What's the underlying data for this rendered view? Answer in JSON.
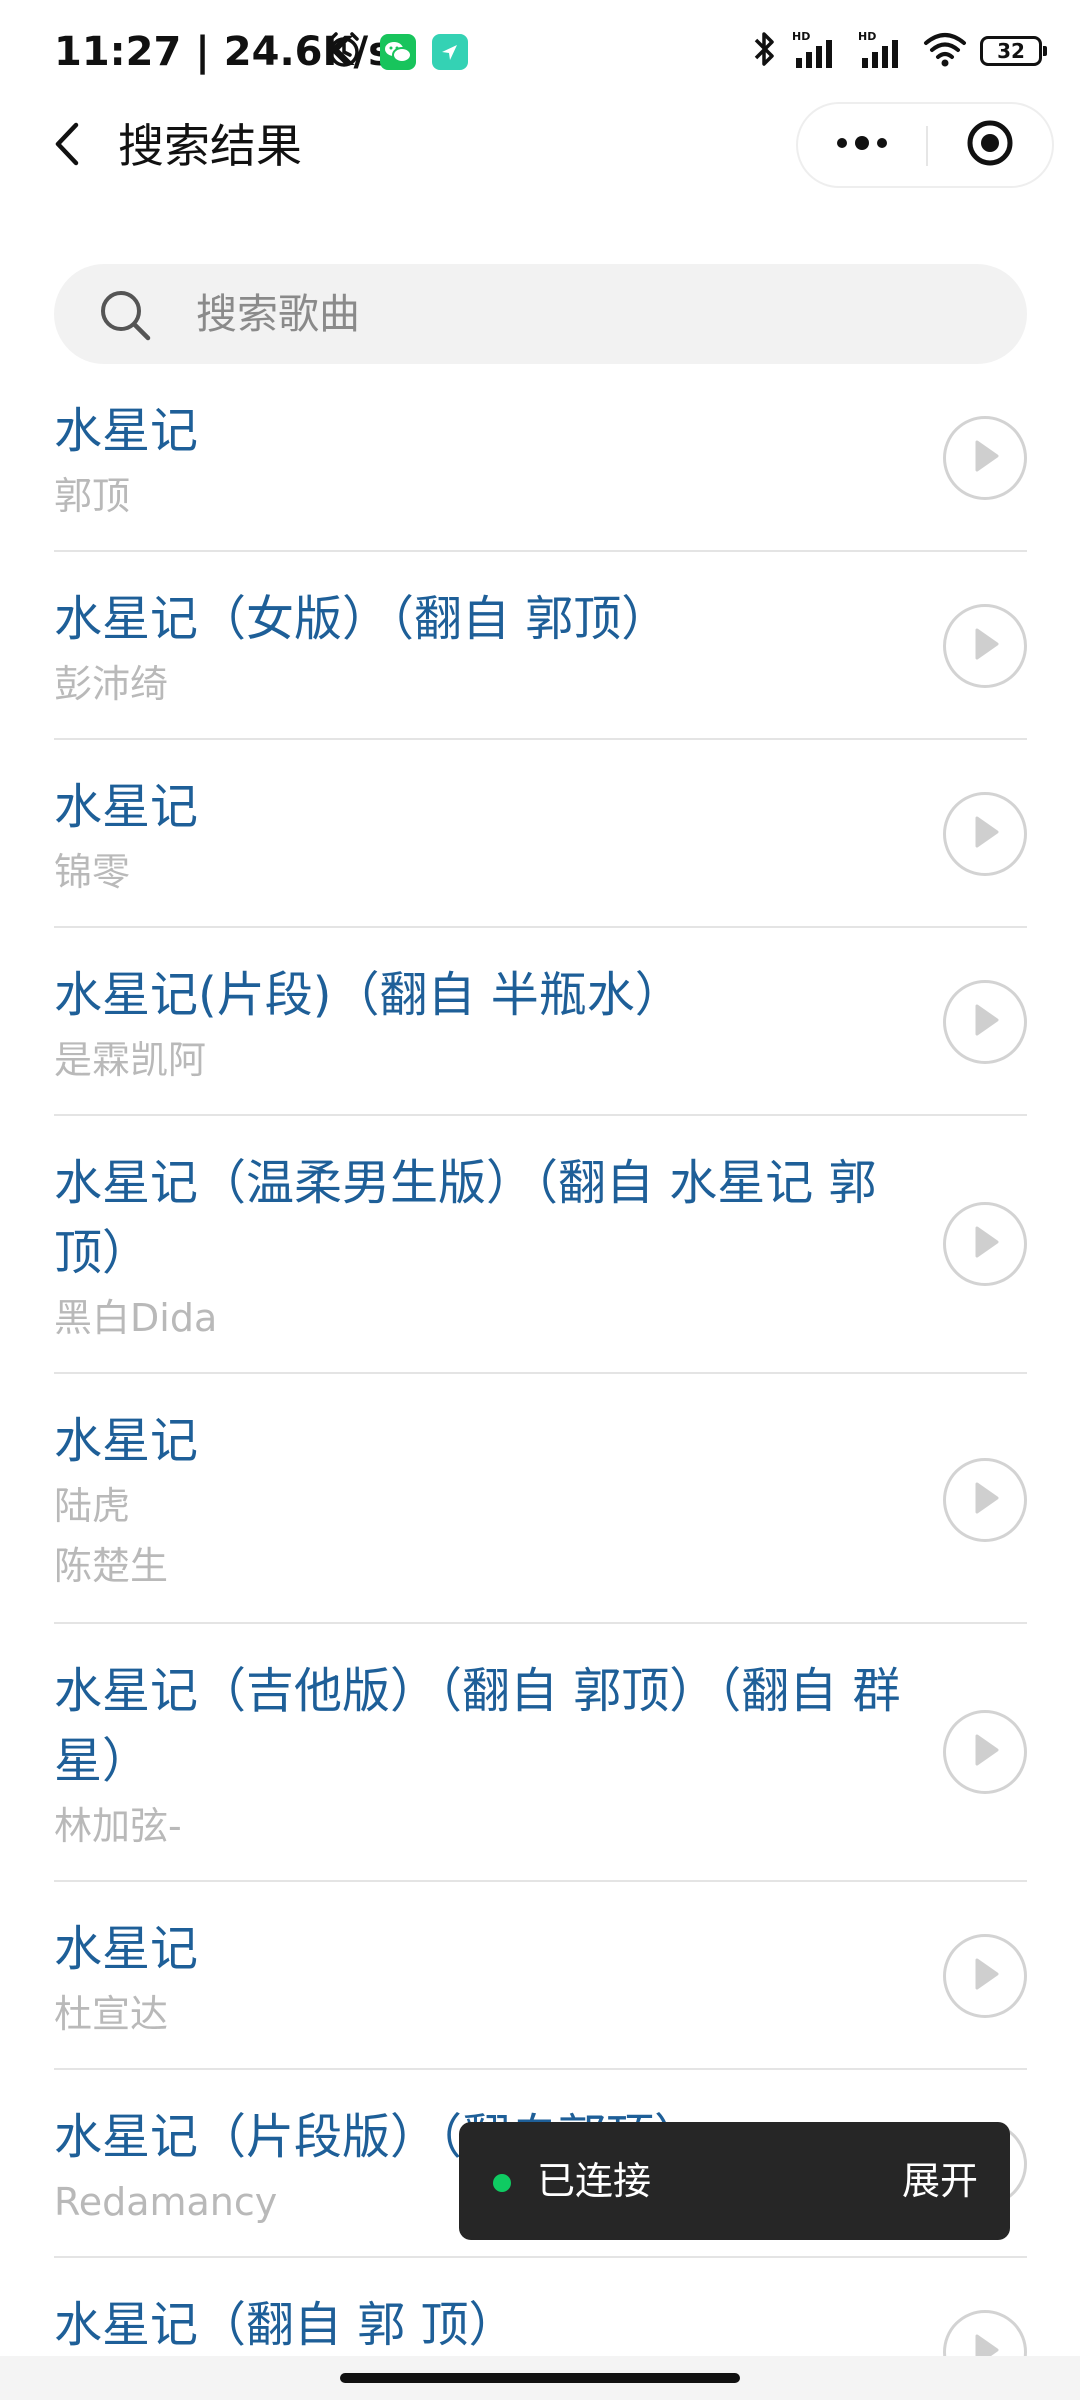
{
  "status_bar": {
    "time_speed": "11:27 | 24.6K/s",
    "battery": "32",
    "icons": [
      "alarm-icon",
      "wechat-icon",
      "location-app-icon",
      "bluetooth-icon",
      "hd-signal-icon",
      "hd-signal-icon",
      "wifi-icon",
      "battery-icon"
    ]
  },
  "nav": {
    "title": "搜索结果",
    "back_icon": "chevron-left-icon",
    "more_icon": "more-dots-icon",
    "close_icon": "record-target-icon"
  },
  "search": {
    "placeholder": "搜索歌曲",
    "value": ""
  },
  "songs": [
    {
      "title": "水星记",
      "artists": [
        "郭顶"
      ]
    },
    {
      "title": "水星记（女版）（翻自 郭顶）",
      "artists": [
        "彭沛绮"
      ]
    },
    {
      "title": "水星记",
      "artists": [
        "锦零"
      ]
    },
    {
      "title": "水星记(片段)（翻自 半瓶水）",
      "artists": [
        "是霖凯阿"
      ]
    },
    {
      "title": "水星记（温柔男生版）（翻自 水星记 郭顶）",
      "artists": [
        "黑白Dida"
      ]
    },
    {
      "title": "水星记",
      "artists": [
        "陆虎",
        "陈楚生"
      ]
    },
    {
      "title": "水星记（吉他版）（翻自 郭顶）（翻自 群星）",
      "artists": [
        "林加弦-"
      ]
    },
    {
      "title": "水星记",
      "artists": [
        "杜宣达"
      ]
    },
    {
      "title": "水星记（片段版）（翻自郭顶）",
      "artists": [
        "Redamancy"
      ]
    },
    {
      "title": "水星记（翻自 郭 顶）",
      "artists": []
    }
  ],
  "toast": {
    "status": "已连接",
    "action": "展开",
    "accent_color": "#0fcb62"
  },
  "colors": {
    "title": "#1e5f98",
    "artist": "#b9b9b9",
    "divider": "#e4e4e4",
    "search_bg": "#f2f2f2"
  }
}
